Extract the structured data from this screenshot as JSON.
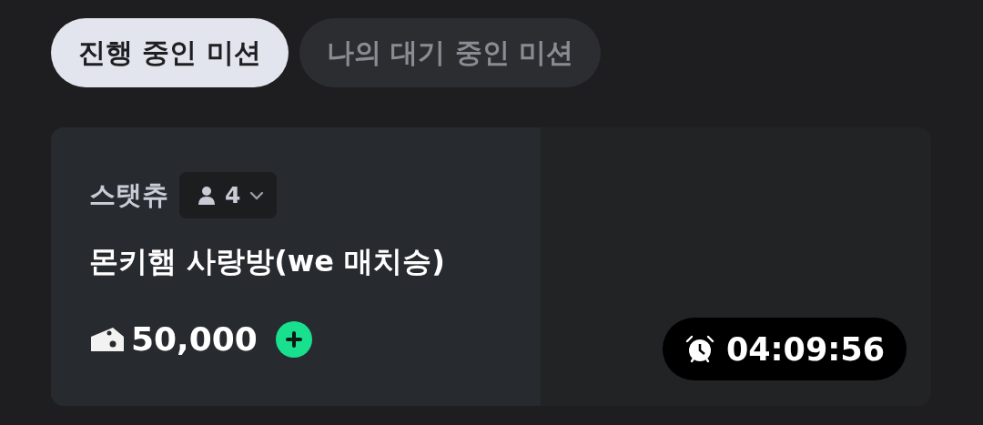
{
  "tabs": [
    {
      "label": "진행 중인 미션",
      "selected": true
    },
    {
      "label": "나의 대기 중인 미션",
      "selected": false
    }
  ],
  "mission": {
    "category": "스탯츄",
    "participants": "4",
    "title": "몬키햄 사랑방(we 매치승)",
    "reward": "50,000",
    "timer": "04:09:56"
  }
}
